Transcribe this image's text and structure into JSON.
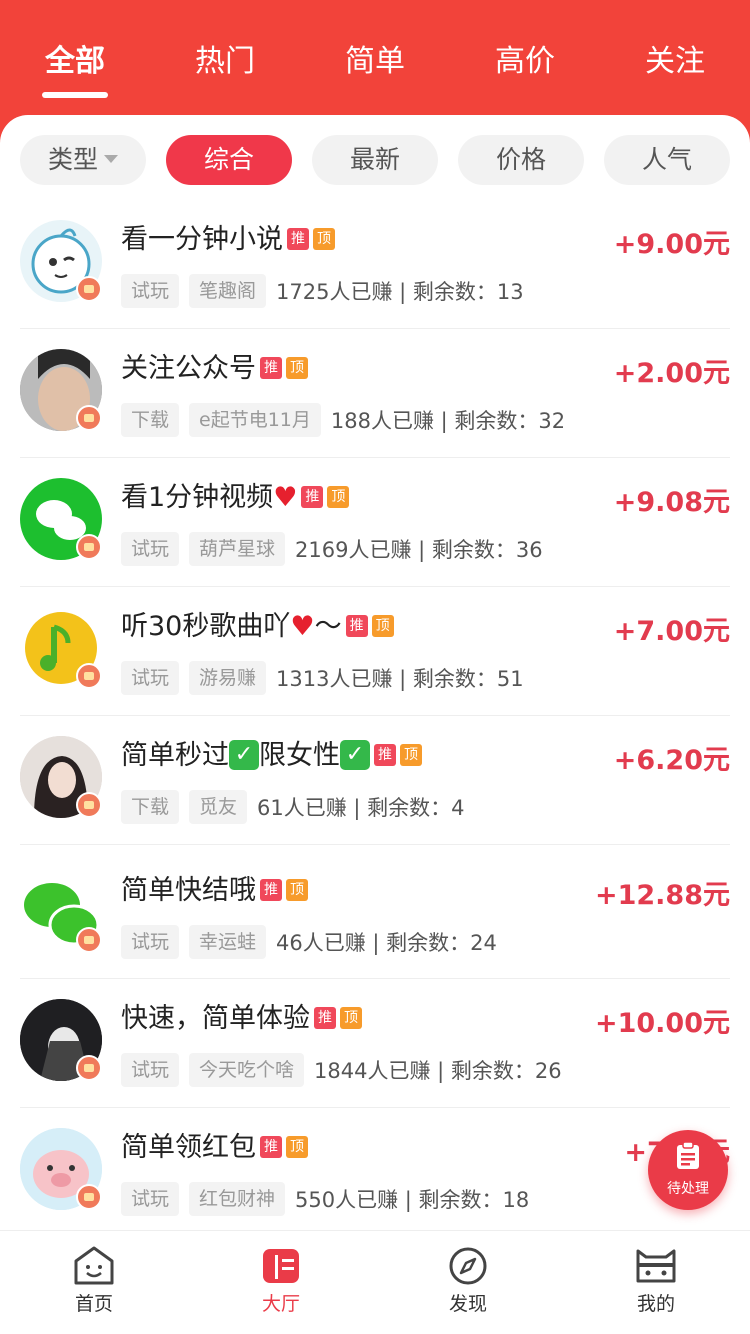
{
  "top_tabs": [
    "全部",
    "热门",
    "简单",
    "高价",
    "关注"
  ],
  "filters": {
    "type_label": "类型",
    "sort_options": [
      "综合",
      "最新",
      "价格",
      "人气"
    ]
  },
  "tag_labels": {
    "recommend": "推",
    "top": "顶"
  },
  "tasks": [
    {
      "title": "看一分钟小说",
      "price": "+9.00元",
      "kind": "试玩",
      "source": "笔趣阁",
      "stats": "1725人已赚 | 剩余数：13"
    },
    {
      "title": "关注公众号",
      "price": "+2.00元",
      "kind": "下载",
      "source": "e起节电11月",
      "stats": "188人已赚 | 剩余数：32"
    },
    {
      "title": "看1分钟视频",
      "price": "+9.08元",
      "kind": "试玩",
      "source": "葫芦星球",
      "stats": "2169人已赚 | 剩余数：36"
    },
    {
      "title": "听30秒歌曲吖",
      "title_suffix": "～",
      "price": "+7.00元",
      "kind": "试玩",
      "source": "游易赚",
      "stats": "1313人已赚 | 剩余数：51"
    },
    {
      "title_a": "简单秒过",
      "title_b": "限女性",
      "price": "+6.20元",
      "kind": "下载",
      "source": "觅友",
      "stats": "61人已赚 | 剩余数：4"
    },
    {
      "title": "简单快结哦",
      "price": "+12.88元",
      "kind": "试玩",
      "source": "幸运蛙",
      "stats": "46人已赚 | 剩余数：24"
    },
    {
      "title": "快速，简单体验",
      "price": "+10.00元",
      "kind": "试玩",
      "source": "今天吃个啥",
      "stats": "1844人已赚 | 剩余数：26"
    },
    {
      "title": "简单领红包",
      "price": "+7.__元",
      "kind": "试玩",
      "source": "红包财神",
      "stats": "550人已赚 | 剩余数：18"
    }
  ],
  "fab": {
    "label": "待处理"
  },
  "bottom_nav": [
    {
      "label": "首页"
    },
    {
      "label": "大厅"
    },
    {
      "label": "发现"
    },
    {
      "label": "我的"
    }
  ],
  "colors": {
    "brand": "#f2433a",
    "accent": "#ea3b48",
    "price": "#e23b4e"
  }
}
